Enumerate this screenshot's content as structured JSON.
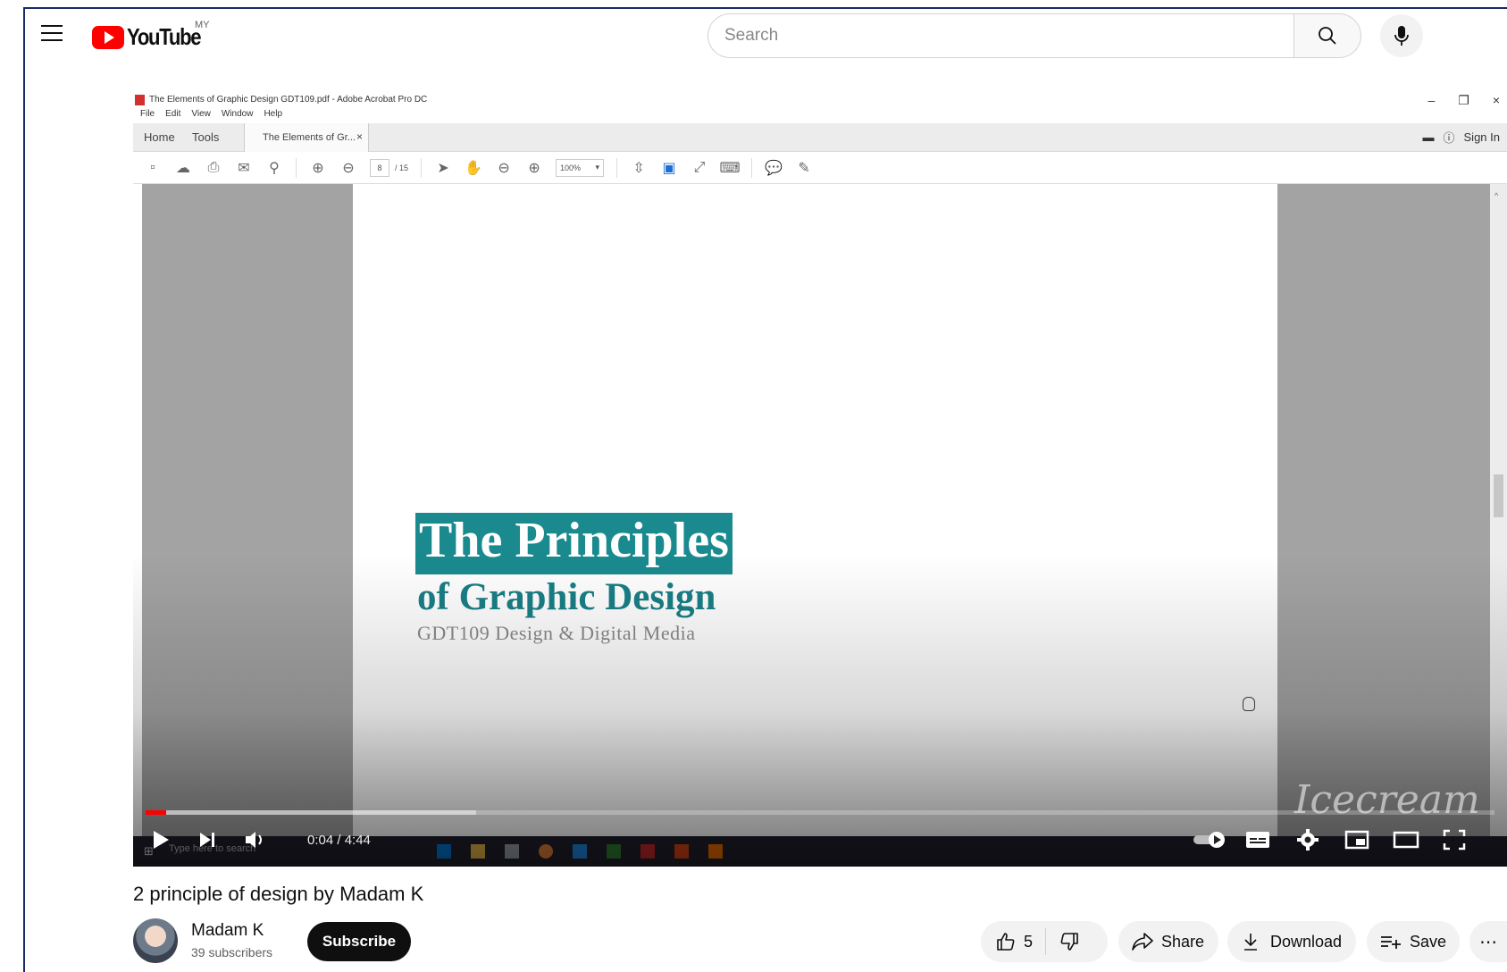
{
  "header": {
    "logo_text": "YouTube",
    "region": "MY",
    "search_placeholder": "Search"
  },
  "acrobat": {
    "window_title": "The Elements of Graphic Design GDT109.pdf - Adobe Acrobat Pro DC",
    "menu": [
      "File",
      "Edit",
      "View",
      "Window",
      "Help"
    ],
    "tabs": {
      "home": "Home",
      "tools": "Tools",
      "doc": "The Elements of Gr...",
      "close": "×"
    },
    "sign_in": "Sign In",
    "page_current": "8",
    "page_total": "/ 15",
    "zoom": "100%",
    "window_controls": [
      "–",
      "❐",
      "×"
    ]
  },
  "slide": {
    "title": "The Principles",
    "subtitle": "of Graphic Design",
    "course": "GDT109 Design & Digital Media"
  },
  "taskbar": {
    "search_text": "Type here to search"
  },
  "player": {
    "time": "0:04 / 4:44",
    "progress_played": 0.015,
    "progress_buffered": 0.245,
    "watermark": "Icecream"
  },
  "video": {
    "title": "2 principle of design by Madam K",
    "channel": "Madam K",
    "subscribers": "39 subscribers",
    "subscribe_label": "Subscribe",
    "likes": "5",
    "share_label": "Share",
    "download_label": "Download",
    "save_label": "Save",
    "more_label": "⋯"
  },
  "colors": {
    "brand_red": "#ff0000",
    "slide_teal": "#1a8a8f"
  }
}
